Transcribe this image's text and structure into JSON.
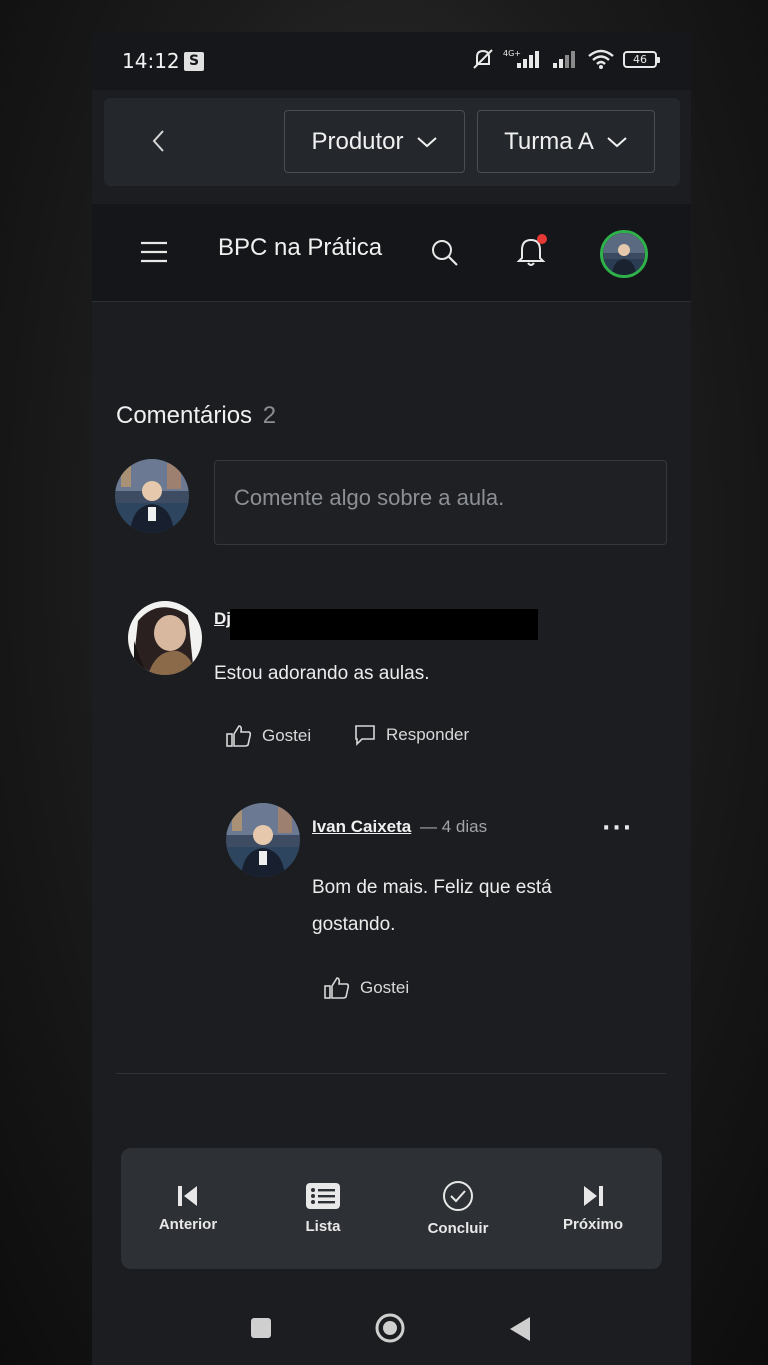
{
  "status_bar": {
    "time": "14:12",
    "s_badge": "S",
    "battery": "46"
  },
  "selectors": {
    "role": "Produtor",
    "class": "Turma A"
  },
  "header": {
    "title": "BPC na Prática"
  },
  "comments": {
    "title": "Comentários",
    "count": "2",
    "input_placeholder": "Comente algo sobre a aula.",
    "items": [
      {
        "author": "Dj",
        "text": "Estou adorando as aulas.",
        "like_label": "Gostei",
        "reply_label": "Responder",
        "replies": [
          {
            "author": "Ivan Caixeta",
            "time": "— 4 dias",
            "text_line1": "Bom de mais. Feliz que está",
            "text_line2": "gostando.",
            "like_label": "Gostei",
            "more": "···"
          }
        ]
      }
    ]
  },
  "bottom_nav": {
    "prev": "Anterior",
    "list": "Lista",
    "complete": "Concluir",
    "next": "Próximo"
  },
  "colors": {
    "background": "#1b1d20",
    "header": "#141619",
    "avatar_ring": "#2fb14a",
    "notification_dot": "#e53935"
  },
  "icons": [
    "back-arrow-icon",
    "chevron-down-icon",
    "hamburger-icon",
    "search-icon",
    "bell-icon",
    "thumbs-up-icon",
    "speech-bubble-icon",
    "more-icon",
    "skip-previous-icon",
    "list-icon",
    "check-circle-icon",
    "skip-next-icon",
    "square-icon",
    "circle-icon",
    "triangle-back-icon"
  ]
}
